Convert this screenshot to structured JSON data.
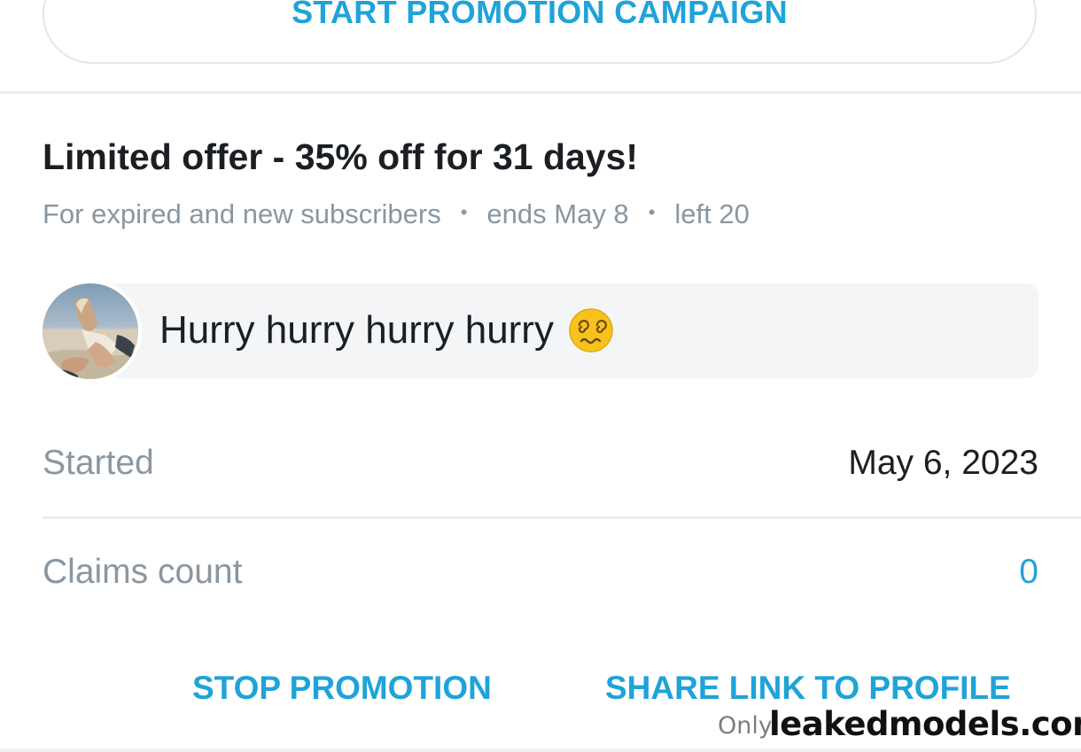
{
  "campaign": {
    "start_button_label": "START PROMOTION CAMPAIGN"
  },
  "offer": {
    "title": "Limited offer - 35% off for 31 days!",
    "audience": "For expired and new subscribers",
    "ends": "ends May 8",
    "left": "left 20",
    "separator": "•",
    "message": "Hurry hurry hurry hurry",
    "message_emoji": "dizzy-face-emoji"
  },
  "details": {
    "started_label": "Started",
    "started_value": "May 6, 2023",
    "claims_label": "Claims count",
    "claims_value": "0"
  },
  "actions": {
    "stop_label": "STOP PROMOTION",
    "share_label": "SHARE LINK TO PROFILE"
  },
  "watermark": {
    "small_text": "Only",
    "big_text": "leakedmodels.com"
  },
  "colors": {
    "accent": "#1fa3d8",
    "muted_text": "#8a96a0",
    "body_text": "#1b1f23",
    "message_bg": "#f3f5f7"
  }
}
